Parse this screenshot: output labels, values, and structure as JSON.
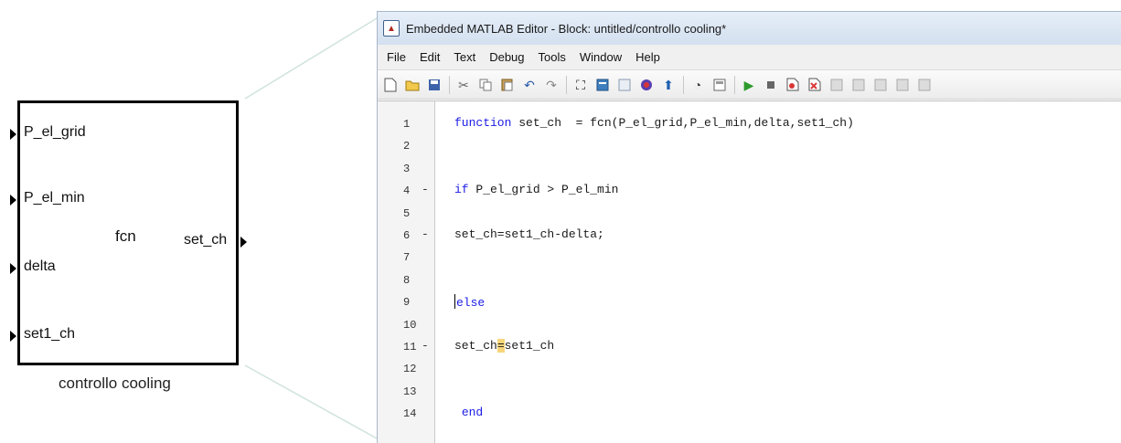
{
  "block": {
    "function_label": "fcn",
    "name": "controllo cooling",
    "inputs": [
      "P_el_grid",
      "P_el_min",
      "delta",
      "set1_ch"
    ],
    "output": "set_ch"
  },
  "editor": {
    "title": "Embedded MATLAB Editor - Block: untitled/controllo cooling*",
    "app_icon": "matlab-editor-icon",
    "menu": [
      "File",
      "Edit",
      "Text",
      "Debug",
      "Tools",
      "Window",
      "Help"
    ],
    "toolbar_icons": [
      "new-file-icon",
      "open-folder-icon",
      "save-icon",
      "|",
      "cut-icon",
      "copy-icon",
      "paste-icon",
      "undo-icon",
      "redo-icon",
      "|",
      "find-icon",
      "goto-icon",
      "document-icon",
      "target-icon",
      "up-arrow-icon",
      "|",
      "history-icon",
      "calculator-icon",
      "|",
      "run-icon",
      "stop-icon",
      "set-breakpoint-icon",
      "clear-breakpoint-icon",
      "step-icon",
      "step-in-icon",
      "step-out-icon",
      "exit-debug-icon",
      "stack-icon"
    ],
    "lines": [
      {
        "num": "1",
        "exec": false,
        "kw": "function",
        "rest": " set_ch  = fcn(P_el_grid,P_el_min,delta,set1_ch)"
      },
      {
        "num": "2",
        "exec": false,
        "kw": "",
        "rest": ""
      },
      {
        "num": "3",
        "exec": false,
        "kw": "",
        "rest": ""
      },
      {
        "num": "4",
        "exec": true,
        "kw": "if",
        "rest": " P_el_grid > P_el_min"
      },
      {
        "num": "5",
        "exec": false,
        "kw": "",
        "rest": ""
      },
      {
        "num": "6",
        "exec": true,
        "kw": "",
        "rest": "set_ch=set1_ch-delta;"
      },
      {
        "num": "7",
        "exec": false,
        "kw": "",
        "rest": ""
      },
      {
        "num": "8",
        "exec": false,
        "kw": "",
        "rest": ""
      },
      {
        "num": "9",
        "exec": false,
        "kw": "else",
        "rest": "",
        "caret": true
      },
      {
        "num": "10",
        "exec": false,
        "kw": "",
        "rest": ""
      },
      {
        "num": "11",
        "exec": true,
        "kw": "",
        "rest": "",
        "split": [
          "set_ch",
          "=",
          "set1_ch"
        ]
      },
      {
        "num": "12",
        "exec": false,
        "kw": "",
        "rest": ""
      },
      {
        "num": "13",
        "exec": false,
        "kw": "",
        "rest": ""
      },
      {
        "num": "14",
        "exec": false,
        "kw": "end",
        "rest": "",
        "indent": " "
      }
    ],
    "exec_marker": "-"
  }
}
